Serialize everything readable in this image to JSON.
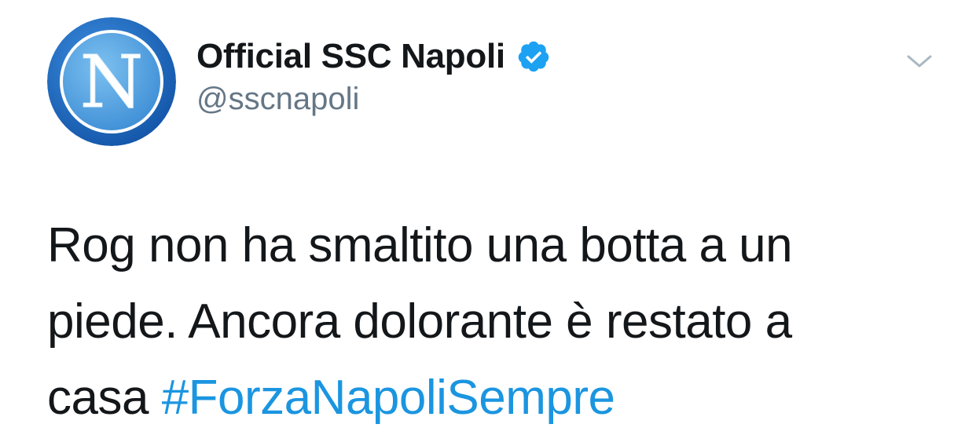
{
  "author": {
    "display_name": "Official SSC Napoli",
    "handle": "@sscnapoli",
    "verified": true,
    "avatar_letter": "N",
    "avatar_colors": {
      "ring": "#1f6fc2",
      "inner": "#5aa9e6",
      "letter": "#ffffff"
    }
  },
  "icons": {
    "verified": "verified-badge-icon",
    "menu": "chevron-down-icon"
  },
  "tweet": {
    "text_line_1": "Rog non ha smaltito una botta a un",
    "text_line_2": "piede. Ancora dolorante è restato a",
    "text_line_3_prefix": "casa ",
    "hashtag": "#ForzaNapoliSempre"
  },
  "colors": {
    "text": "#14171a",
    "secondary": "#657786",
    "link": "#1b95e0",
    "verified": "#1da1f2",
    "caret": "#aab8c2"
  }
}
